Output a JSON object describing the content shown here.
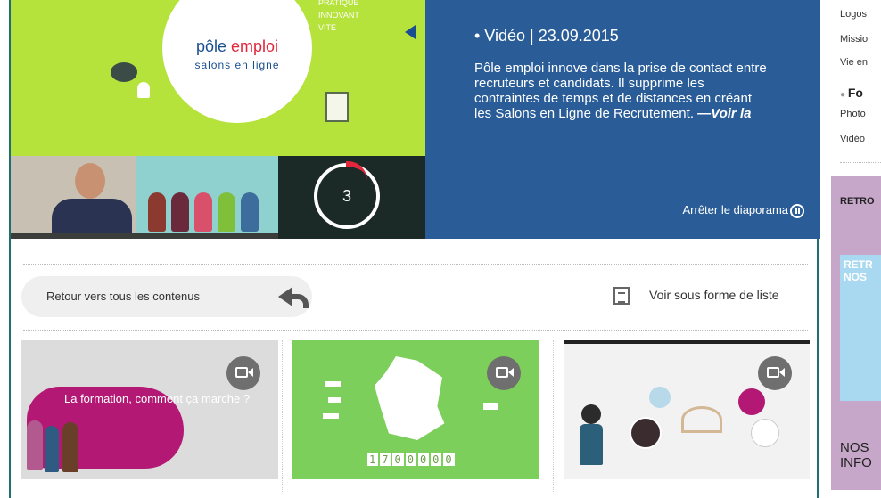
{
  "hero": {
    "logo_word1": "pôle",
    "logo_word2": "emploi",
    "logo_sub": "salons en ligne",
    "small_text": [
      "PRATIQUE",
      "INNOVANT",
      "VITE"
    ],
    "timer_value": "3",
    "video_label": "• Vidéo | 23.09.2015",
    "description": "Pôle emploi innove dans la prise de contact entre recruteurs et candidats. Il supprime les contraintes de temps et de distances en créant les Salons en Ligne de Recrutement.",
    "see_more": "—Voir la",
    "stop_label": "Arrêter le diaporama"
  },
  "controls": {
    "back_label": "Retour vers tous les contenus",
    "list_label": "Voir sous forme de liste"
  },
  "cards": [
    {
      "overlay_text": "La formation, comment ça marche ?"
    },
    {
      "counter": [
        "1",
        "7",
        "0",
        "0",
        "0",
        "0",
        "0"
      ]
    },
    {}
  ],
  "sidebar": {
    "links_top": [
      "Logos",
      "Missio",
      "Vie en"
    ],
    "section_head": "Fo",
    "links_bottom": [
      "Photo",
      "Vidéo"
    ],
    "retro_label": "RETRO",
    "promo_text": "RETR NOS",
    "nos_text": "NOS INFO"
  },
  "colors": {
    "hero_green": "#b5e23b",
    "hero_blue": "#2a5d97",
    "accent_magenta": "#b31974",
    "brand_blue": "#1a4e8f",
    "brand_red": "#e3263b"
  }
}
